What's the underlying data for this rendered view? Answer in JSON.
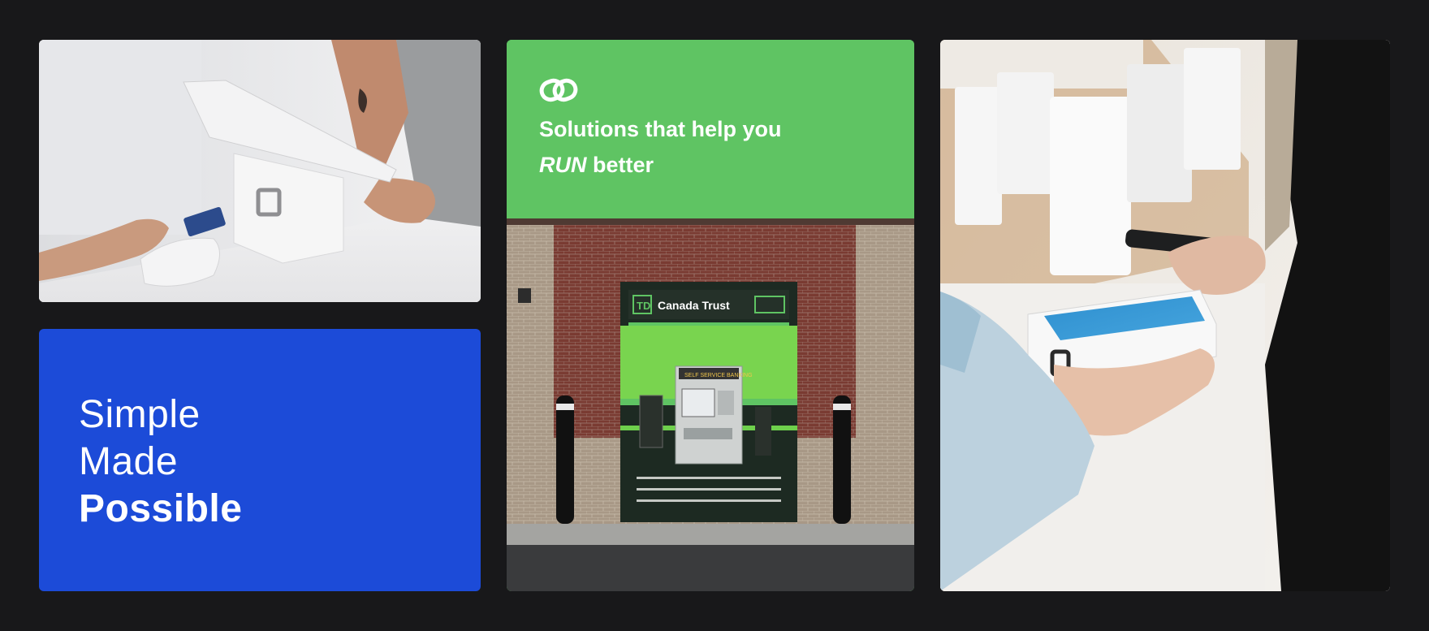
{
  "cards": {
    "pos_photo": {
      "icon": "square-logo-icon"
    },
    "tagline": {
      "lines": [
        "Simple",
        "Made",
        "Possible"
      ],
      "background": "#1c4bd8"
    },
    "atm": {
      "logo_icon": "chain-link-logo-icon",
      "heading_line1": "Solutions that help you",
      "heading_line2_em": "RUN",
      "heading_line2_rest": " better",
      "header_background": "#5fc463",
      "sign_text": "Canada Trust",
      "sign_badge": "TD",
      "machine_label": "SELF SERVICE BANKING"
    },
    "nfc_photo": {
      "icon": "contactless-icon"
    }
  },
  "colors": {
    "page_background": "#18181a",
    "accent_blue": "#1c4bd8",
    "accent_green": "#5fc463"
  }
}
